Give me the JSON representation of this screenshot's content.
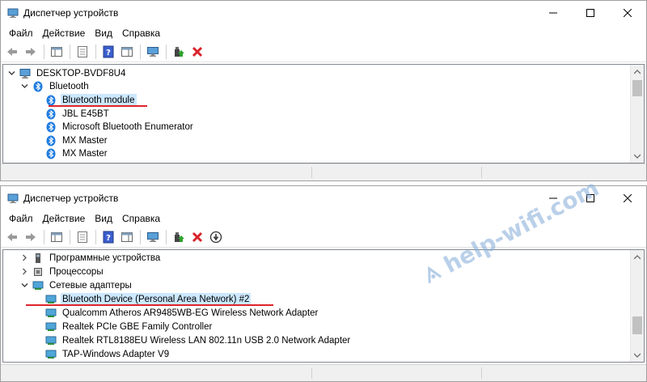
{
  "window1": {
    "title": "Диспетчер устройств",
    "menu": [
      "Файл",
      "Действие",
      "Вид",
      "Справка"
    ],
    "tree": [
      {
        "label": "DESKTOP-BVDF8U4",
        "level": 0,
        "expanded": true,
        "icon": "computer-icon"
      },
      {
        "label": "Bluetooth",
        "level": 1,
        "expanded": true,
        "icon": "bluetooth-icon"
      },
      {
        "label": "Bluetooth module",
        "level": 2,
        "icon": "bluetooth-icon",
        "selected": true
      },
      {
        "label": "JBL E45BT",
        "level": 2,
        "icon": "bluetooth-icon"
      },
      {
        "label": "Microsoft Bluetooth Enumerator",
        "level": 2,
        "icon": "bluetooth-icon"
      },
      {
        "label": "MX Master",
        "level": 2,
        "icon": "bluetooth-icon"
      },
      {
        "label": "MX Master",
        "level": 2,
        "icon": "bluetooth-icon"
      }
    ]
  },
  "window2": {
    "title": "Диспетчер устройств",
    "menu": [
      "Файл",
      "Действие",
      "Вид",
      "Справка"
    ],
    "tree": [
      {
        "label": "Программные устройства",
        "level": 1,
        "expanded": false,
        "icon": "software-device-icon"
      },
      {
        "label": "Процессоры",
        "level": 1,
        "expanded": false,
        "icon": "processor-icon"
      },
      {
        "label": "Сетевые адаптеры",
        "level": 1,
        "expanded": true,
        "icon": "network-adapter-icon"
      },
      {
        "label": "Bluetooth Device (Personal Area Network) #2",
        "level": 2,
        "icon": "network-adapter-icon",
        "selected": true
      },
      {
        "label": "Qualcomm Atheros AR9485WB-EG Wireless Network Adapter",
        "level": 2,
        "icon": "network-adapter-icon"
      },
      {
        "label": "Realtek PCIe GBE Family Controller",
        "level": 2,
        "icon": "network-adapter-icon"
      },
      {
        "label": "Realtek RTL8188EU Wireless LAN 802.11n USB 2.0 Network Adapter",
        "level": 2,
        "icon": "network-adapter-icon"
      },
      {
        "label": "TAP-Windows Adapter V9",
        "level": 2,
        "icon": "network-adapter-icon"
      }
    ]
  },
  "watermark": {
    "text": "help-wifi.com"
  },
  "colors": {
    "selection": "#cce8ff",
    "underline": "#e0242c",
    "bluetooth": "#1e7be0",
    "delete": "#d9232b"
  }
}
